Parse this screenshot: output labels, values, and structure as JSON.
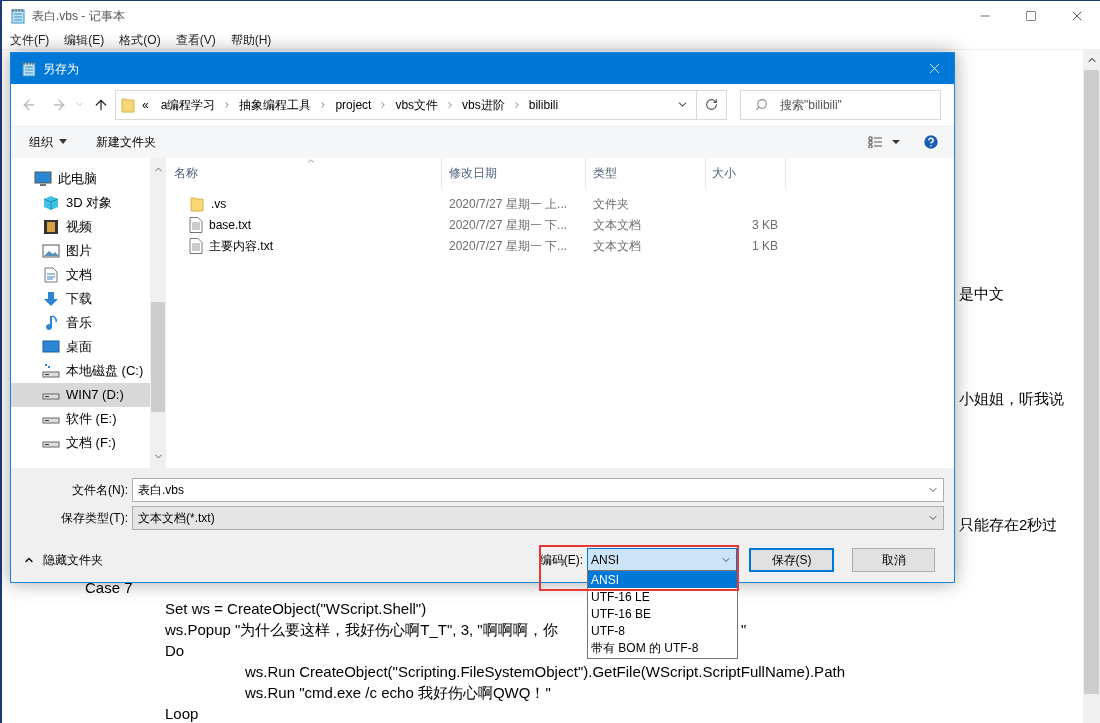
{
  "notepad": {
    "title": "表白.vbs - 记事本",
    "menu": [
      "文件(F)",
      "编辑(E)",
      "格式(O)",
      "查看(V)",
      "帮助(H)"
    ],
    "text_fragments": [
      {
        "text": "是中文"
      },
      {
        "text": "小姐姐，听我说"
      },
      {
        "text": "只能存在2秒过"
      },
      {
        "text": "Case 7"
      },
      {
        "text": "Set ws = CreateObject(\"WScript.Shell\")"
      },
      {
        "text": "ws.Popup \"为什么要这样，我好伤心啊T_T\", 3, \"啊啊啊，你"
      },
      {
        "text": "\""
      },
      {
        "text": "Do"
      },
      {
        "text": "ws.Run CreateObject(\"Scripting.FileSystemObject\").GetFile(WScript.ScriptFullName).Path"
      },
      {
        "text": "ws.Run \"cmd.exe /c echo 我好伤心啊QWQ！\""
      },
      {
        "text": "Loop"
      }
    ]
  },
  "dialog": {
    "title": "另存为",
    "breadcrumb": {
      "overflow": "«",
      "crumbs": [
        "a编程学习",
        "抽象编程工具",
        "project",
        "vbs文件",
        "vbs进阶",
        "bilibili"
      ]
    },
    "search": {
      "placeholder": "搜索\"bilibili\""
    },
    "toolbar": {
      "organize": "组织",
      "new_folder": "新建文件夹"
    },
    "sidebar": {
      "items": [
        {
          "label": "此电脑",
          "selected": false,
          "children": [
            {
              "label": "3D 对象",
              "selected": false
            },
            {
              "label": "视频",
              "selected": false
            },
            {
              "label": "图片",
              "selected": false
            },
            {
              "label": "文档",
              "selected": false
            },
            {
              "label": "下载",
              "selected": false
            },
            {
              "label": "音乐",
              "selected": false
            },
            {
              "label": "桌面",
              "selected": false
            },
            {
              "label": "本地磁盘 (C:)",
              "selected": false
            },
            {
              "label": "WIN7 (D:)",
              "selected": true
            },
            {
              "label": "软件 (E:)",
              "selected": false
            },
            {
              "label": "文档 (F:)",
              "selected": false
            }
          ]
        }
      ]
    },
    "table": {
      "columns": [
        "名称",
        "修改日期",
        "类型",
        "大小"
      ],
      "rows": [
        {
          "kind": "folder",
          "name": ".vs",
          "modified": "2020/7/27 星期一 上...",
          "type": "文件夹"
        },
        {
          "kind": "file",
          "name": "base.txt",
          "modified": "2020/7/27 星期一 下...",
          "type": "文本文档",
          "size": "3 KB"
        },
        {
          "kind": "file",
          "name": "主要内容.txt",
          "modified": "2020/7/27 星期一 下...",
          "type": "文本文档",
          "size": "1 KB"
        }
      ]
    },
    "filename": {
      "label": "文件名(N):",
      "value": "表白.vbs"
    },
    "filetype": {
      "label": "保存类型(T):",
      "value": "文本文档(*.txt)"
    },
    "hide_folders": "隐藏文件夹",
    "encoding": {
      "label": "编码(E):",
      "value": "ANSI",
      "expanded": true,
      "options": [
        {
          "label": "ANSI",
          "selected": true
        },
        {
          "label": "UTF-16 LE",
          "selected": false
        },
        {
          "label": "UTF-16 BE",
          "selected": false
        },
        {
          "label": "UTF-8",
          "selected": false
        },
        {
          "label": "带有 BOM 的 UTF-8",
          "selected": false
        }
      ]
    },
    "buttons": [
      "保存(S)",
      "取消"
    ]
  }
}
